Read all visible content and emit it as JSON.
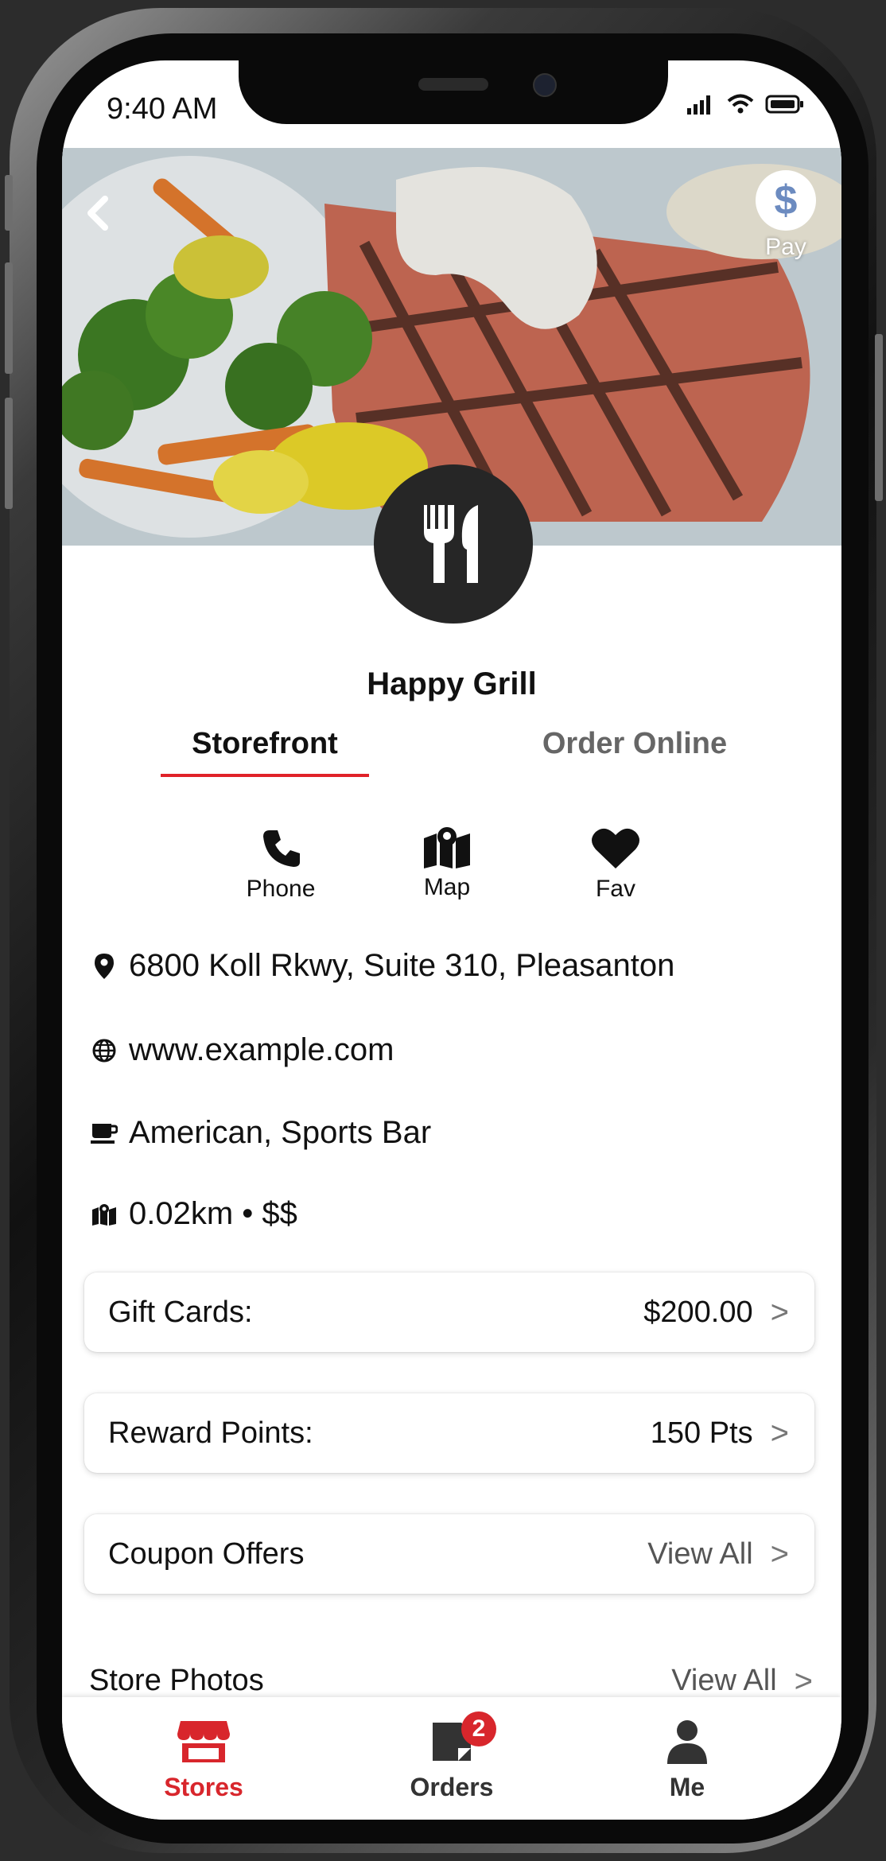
{
  "status_bar": {
    "time": "9:40 AM"
  },
  "hero": {
    "pay_label": "Pay",
    "pay_symbol": "$"
  },
  "store": {
    "name": "Happy Grill"
  },
  "tabs": [
    {
      "label": "Storefront",
      "active": true
    },
    {
      "label": "Order Online",
      "active": false
    }
  ],
  "actions": [
    {
      "label": "Phone",
      "icon": "phone-icon"
    },
    {
      "label": "Map",
      "icon": "map-icon"
    },
    {
      "label": "Fav",
      "icon": "heart-icon"
    }
  ],
  "info": {
    "address": "6800 Koll Rkwy, Suite 310, Pleasanton",
    "website": "www.example.com",
    "cuisine": "American, Sports Bar",
    "distance_price": "0.02km • $$"
  },
  "cards": {
    "gift_cards": {
      "label": "Gift Cards:",
      "value": "$200.00"
    },
    "reward_points": {
      "label": "Reward Points:",
      "value": "150 Pts"
    },
    "coupons": {
      "label": "Coupon Offers",
      "value": "View All"
    },
    "store_photos": {
      "label": "Store Photos",
      "value": "View All"
    }
  },
  "chevron": ">",
  "bottom_nav": {
    "items": [
      {
        "label": "Stores",
        "icon": "storefront-icon",
        "active": true
      },
      {
        "label": "Orders",
        "icon": "orders-icon",
        "badge": "2"
      },
      {
        "label": "Me",
        "icon": "user-icon"
      }
    ]
  },
  "colors": {
    "accent": "#d8262c",
    "pay_icon": "#6c8bc0"
  }
}
